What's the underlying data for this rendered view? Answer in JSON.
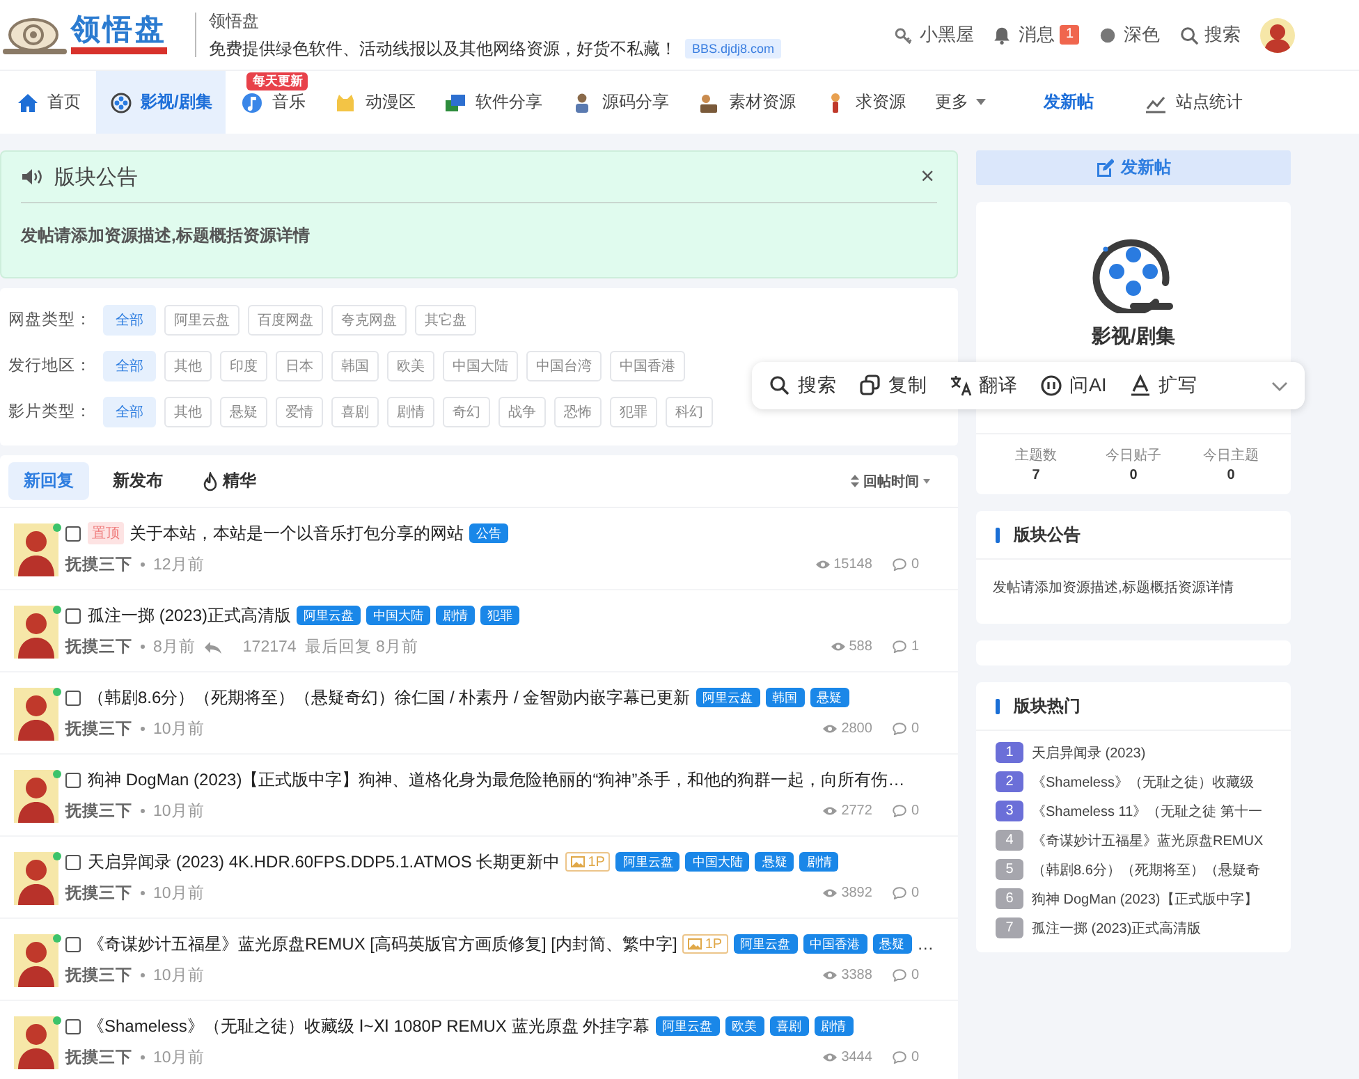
{
  "header": {
    "logo_text": "领悟盘",
    "site_name": "领悟盘",
    "tagline": "免费提供绿色软件、活动线报以及其他网络资源，好货不私藏！",
    "domain": "BBS.djdj8.com",
    "links": [
      {
        "label": "小黑屋"
      },
      {
        "label": "消息",
        "badge": "1"
      },
      {
        "label": "深色"
      },
      {
        "label": "搜索"
      }
    ]
  },
  "nav": {
    "items": [
      {
        "kind": "link",
        "label": "首页",
        "selected": false
      },
      {
        "kind": "link",
        "label": "影视/剧集",
        "selected": true
      },
      {
        "kind": "link",
        "label": "音乐",
        "selected": false,
        "badge": "每天更新"
      },
      {
        "kind": "link",
        "label": "动漫区",
        "selected": false
      },
      {
        "kind": "link",
        "label": "软件分享",
        "selected": false
      },
      {
        "kind": "link",
        "label": "源码分享",
        "selected": false
      },
      {
        "kind": "link",
        "label": "素材资源",
        "selected": false
      },
      {
        "kind": "link",
        "label": "求资源",
        "selected": false
      },
      {
        "kind": "menu",
        "label": "更多",
        "selected": false
      },
      {
        "kind": "action",
        "label": "发新帖",
        "selected": false
      },
      {
        "kind": "link",
        "label": "站点统计",
        "selected": false
      }
    ]
  },
  "notice": {
    "title": "版块公告",
    "text": "发帖请添加资源描述,标题概括资源详情",
    "close": "×"
  },
  "filters": [
    {
      "label": "网盘类型：",
      "options": [
        {
          "label": "全部",
          "selected": true
        },
        {
          "label": "阿里云盘",
          "selected": false
        },
        {
          "label": "百度网盘",
          "selected": false
        },
        {
          "label": "夸克网盘",
          "selected": false
        },
        {
          "label": "其它盘",
          "selected": false
        }
      ]
    },
    {
      "label": "发行地区：",
      "options": [
        {
          "label": "全部",
          "selected": true
        },
        {
          "label": "其他",
          "selected": false
        },
        {
          "label": "印度",
          "selected": false
        },
        {
          "label": "日本",
          "selected": false
        },
        {
          "label": "韩国",
          "selected": false
        },
        {
          "label": "欧美",
          "selected": false
        },
        {
          "label": "中国大陆",
          "selected": false
        },
        {
          "label": "中国台湾",
          "selected": false
        },
        {
          "label": "中国香港",
          "selected": false
        }
      ]
    },
    {
      "label": "影片类型：",
      "options": [
        {
          "label": "全部",
          "selected": true
        },
        {
          "label": "其他",
          "selected": false
        },
        {
          "label": "悬疑",
          "selected": false
        },
        {
          "label": "爱情",
          "selected": false
        },
        {
          "label": "喜剧",
          "selected": false
        },
        {
          "label": "剧情",
          "selected": false
        },
        {
          "label": "奇幻",
          "selected": false
        },
        {
          "label": "战争",
          "selected": false
        },
        {
          "label": "恐怖",
          "selected": false
        },
        {
          "label": "犯罪",
          "selected": false
        },
        {
          "label": "科幻",
          "selected": false
        }
      ]
    }
  ],
  "thread_list": {
    "tabs": [
      {
        "label": "新回复",
        "selected": true
      },
      {
        "label": "新发布",
        "selected": false
      },
      {
        "label": "精华",
        "selected": false
      }
    ],
    "sort": "回帖时间",
    "threads": [
      {
        "checked": false,
        "online": true,
        "prefix": "置顶",
        "title": "关于本站，本站是一个以音乐打包分享的网站",
        "tags": [
          "公告"
        ],
        "author": "抚摸三下",
        "time": "12月前",
        "views": "15148",
        "replies": "0"
      },
      {
        "checked": false,
        "online": true,
        "title": "孤注一掷 (2023)正式高清版",
        "tags": [
          "阿里云盘",
          "中国大陆",
          "剧情",
          "犯罪"
        ],
        "author": "抚摸三下",
        "time": "8月前",
        "replier": "172174",
        "last_reply": "最后回复 8月前",
        "views": "588",
        "replies": "1"
      },
      {
        "checked": false,
        "online": true,
        "title": "（韩剧8.6分）（死期将至）（悬疑奇幻）徐仁国 / 朴素丹 / 金智勋内嵌字幕已更新",
        "tags": [
          "阿里云盘",
          "韩国",
          "悬疑"
        ],
        "author": "抚摸三下",
        "time": "10月前",
        "views": "2800",
        "replies": "0"
      },
      {
        "checked": false,
        "online": true,
        "title": "狗神 DogMan (2023)【正式版中字】狗神、道格化身为最危险艳丽的“狗神”杀手，和他的狗群一起，向所有伤…",
        "author": "抚摸三下",
        "time": "10月前",
        "views": "2772",
        "replies": "0"
      },
      {
        "checked": false,
        "online": true,
        "title": "天启异闻录 (2023) 4K.HDR.60FPS.DDP5.1.ATMOS 长期更新中",
        "image_badge": "1P",
        "tags": [
          "阿里云盘",
          "中国大陆",
          "悬疑",
          "剧情"
        ],
        "author": "抚摸三下",
        "time": "10月前",
        "views": "3892",
        "replies": "0"
      },
      {
        "checked": false,
        "online": true,
        "title": "《奇谋妙计五福星》蓝光原盘REMUX [高码英版官方画质修复] [内封简、繁中字]",
        "image_badge": "1P",
        "tags": [
          "阿里云盘",
          "中国香港",
          "悬疑"
        ],
        "more": "…",
        "author": "抚摸三下",
        "time": "10月前",
        "views": "3388",
        "replies": "0"
      },
      {
        "checked": false,
        "online": true,
        "title": "《Shameless》（无耻之徒）收藏级 Ⅰ~Ⅺ 1080P REMUX 蓝光原盘 外挂字幕",
        "tags": [
          "阿里云盘",
          "欧美",
          "喜剧",
          "剧情"
        ],
        "author": "抚摸三下",
        "time": "10月前",
        "views": "3444",
        "replies": "0"
      }
    ]
  },
  "sidebar": {
    "post_button": "发新帖",
    "forum": {
      "name": "影视/剧集",
      "stats": [
        {
          "label": "主题数",
          "value": "7"
        },
        {
          "label": "今日贴子",
          "value": "0"
        },
        {
          "label": "今日主题",
          "value": "0"
        }
      ]
    },
    "notice": {
      "title": "版块公告",
      "text": "发帖请添加资源描述,标题概括资源详情"
    },
    "hot": {
      "title": "版块热门",
      "items": [
        {
          "rank": "1",
          "title": "天启异闻录 (2023)",
          "color": "#6b6fd8"
        },
        {
          "rank": "2",
          "title": "《Shameless》（无耻之徒）收藏级",
          "color": "#6b6fd8"
        },
        {
          "rank": "3",
          "title": "《Shameless 11》（无耻之徒 第十一",
          "color": "#6b6fd8"
        },
        {
          "rank": "4",
          "title": "《奇谋妙计五福星》蓝光原盘REMUX",
          "color": "#a6a6ad"
        },
        {
          "rank": "5",
          "title": "（韩剧8.6分）（死期将至）（悬疑奇",
          "color": "#a6a6ad"
        },
        {
          "rank": "6",
          "title": "狗神 DogMan (2023)【正式版中字】",
          "color": "#a6a6ad"
        },
        {
          "rank": "7",
          "title": "孤注一掷 (2023)正式高清版",
          "color": "#a6a6ad"
        }
      ]
    }
  },
  "selection_toolbar": {
    "items": [
      {
        "label": "搜索"
      },
      {
        "label": "复制"
      },
      {
        "label": "翻译"
      },
      {
        "label": "问AI"
      },
      {
        "label": "扩写"
      }
    ]
  }
}
